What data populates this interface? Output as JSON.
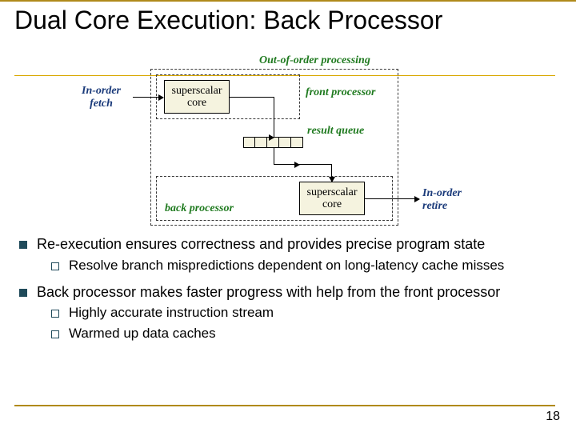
{
  "title": "Dual Core Execution: Back Processor",
  "diagram": {
    "ooo_label": "Out-of-order  processing",
    "front_label": "front processor",
    "back_label": "back processor",
    "fetch_label": "In-order\nfetch",
    "result_queue_label": "result queue",
    "retire_label": "In-order\nretire",
    "core1": "superscalar\ncore",
    "core2": "superscalar\ncore"
  },
  "bullets": [
    {
      "text": "Re-execution ensures correctness and provides precise program state",
      "sub": [
        "Resolve branch mispredictions dependent on long-latency cache misses"
      ]
    },
    {
      "text": "Back processor makes faster progress with help from the front processor",
      "sub": [
        "Highly accurate instruction stream",
        "Warmed up data caches"
      ]
    }
  ],
  "page": "18"
}
